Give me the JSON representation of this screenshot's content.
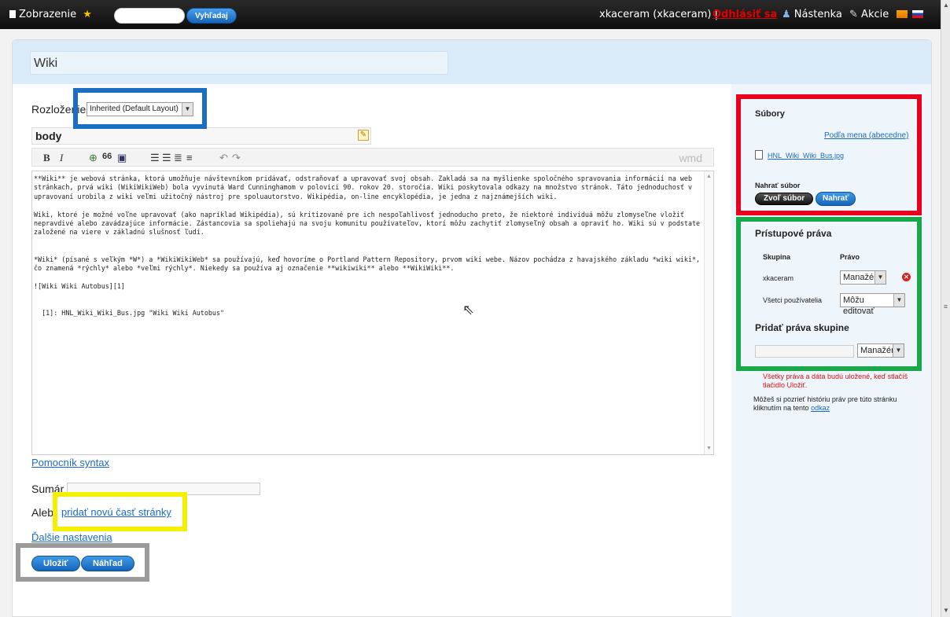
{
  "topbar": {
    "view_label": "Zobrazenie",
    "search_button": "Vyhľadaj",
    "user": "xkaceram (xkaceram) |",
    "logout": "Odhlásiť sa",
    "dashboard": "Nástenka",
    "actions": "Akcie"
  },
  "page": {
    "title": "Wiki",
    "layout_label": "Rozloženie",
    "layout_value": "Inherited (Default Layout)",
    "body_field": "body",
    "toolbar": {
      "bold": "B",
      "italic": "I",
      "quote": "66",
      "wmd": "wmd"
    },
    "editor_text": "**Wiki** je webová stránka, ktorá umožňuje návštevníkom pridávať, odstraňovať a upravovať svoj obsah. Zakladá sa na myšlienke spoločného spravovania informácií na web stránkach, prvá wiki (WikiWikiWeb) bola vyvinutá Ward Cunninghamom v polovici 90. rokov 20. storočia. Wiki poskytovala odkazy na množstvo stránok. Táto jednoduchosť v upravovaní urobila z wiki veľmi užitočný nástroj pre spoluautorstvo. Wikipédia, on-line encyklopédia, je jedna z najznámejších wiki.\n\nWiki, ktoré je možné voľne upravovať (ako napríklad Wikipédia), sú kritizované pre ich nespoľahlivosť jednoducho preto, že niektoré individuá môžu zlomyseľne vložiť nepravdivé alebo zavádzajúce informácie. Zástancovia sa spoliehajú na svoju komunitu používateľov, ktorí môžu zachytiť zlomyseľný obsah a opraviť ho. Wiki sú v podstate založené na viere v základnú slušnosť ľudí.\n\n\n*Wiki* (písané s veľkým *W*) a *WikiWikiWeb* sa používajú, keď hovoríme o Portland Pattern Repository, prvom wiki webe. Názov pochádza z havajského základu *wiki wiki*, čo znamená *rýchly* alebo *veľmi rýchly*. Niekedy sa používa aj označenie **wikiwiki** alebo **WikiWiki**.\n\n![Wiki Wiki Autobus][1]\n\n\n  [1]: HNL_Wiki_Wiki_Bus.jpg \"Wiki Wiki Autobus\"",
    "syntax_help": "Pomocník syntax",
    "summary_label": "Sumár",
    "or_label": "Aleb",
    "add_section": "pridať novú časť stránky",
    "more_settings": "Ďalšie nastavenia",
    "save": "Uložiť",
    "preview": "Náhľad"
  },
  "sidebar": {
    "files_title": "Súbory",
    "sort_link": "Podľa mena (abecedne)",
    "file_name": "HNL_Wiki_Wiki_Bus.jpg",
    "upload_label": "Nahrať súbor",
    "choose_file": "Zvoľ súbor",
    "upload_button": "Nahrať",
    "perm_title": "Prístupové práva",
    "col_group": "Skupina",
    "col_right": "Právo",
    "rows": [
      {
        "group": "xkaceram",
        "right": "Manažér"
      },
      {
        "group": "Všetci používatelia",
        "right": "Môžu editovať"
      }
    ],
    "add_group_title": "Pridať práva skupine",
    "add_group_right": "Manažér",
    "warning": "Všetky práva a dáta budú uložené, keď stlačíš tlačidlo Uložiť.",
    "history_text": "Môžeš si pozrieť históriu práv pre túto stránku kliknutím na tento",
    "history_link": "odkaz"
  },
  "colors": {
    "highlight_blue": "#1a6fc4",
    "highlight_red": "#e8001c",
    "highlight_green": "#18a84a",
    "highlight_yellow": "#f5f000",
    "highlight_gray": "#9a9a9a"
  }
}
